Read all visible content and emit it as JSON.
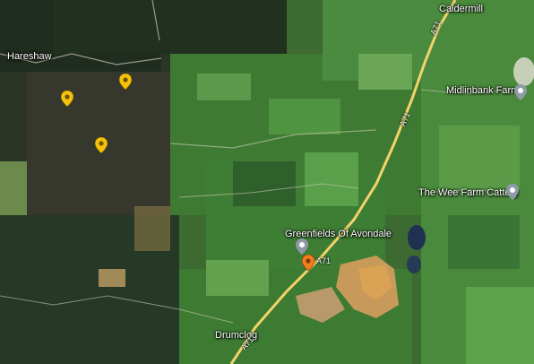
{
  "map": {
    "places": {
      "caldermill": "Caldermill",
      "hareshaw": "Hareshaw",
      "drumclog": "Drumclog"
    },
    "road_labels": {
      "a71_north": "A71",
      "a71_mid": "A71",
      "a71_center": "A71",
      "a71_south": "A71"
    },
    "poi": {
      "midlinbank": "Midlinbank Farm",
      "wee_farm": "The Wee Farm Cattery",
      "greenfields": "Greenfields Of Avondale"
    },
    "colors": {
      "road": "#f3d36a",
      "poi_grey": "#8e9aa6",
      "pin_yellow": "#f4c20d",
      "pin_orange": "#f57c1f"
    },
    "icons": {
      "poi": "map-pin-icon",
      "selected": "map-pin-orange-icon",
      "yellow": "map-pin-yellow-icon"
    }
  }
}
